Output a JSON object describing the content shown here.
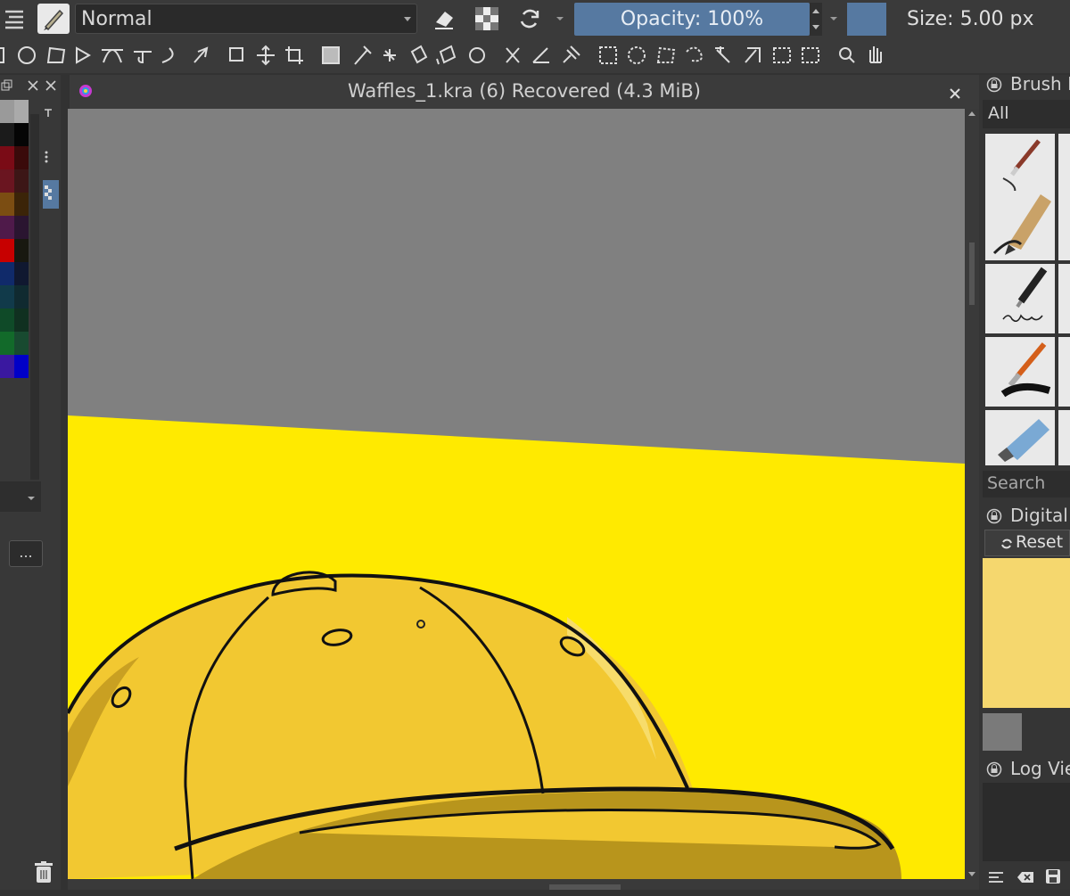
{
  "toolbar": {
    "blend_mode": "Normal",
    "opacity_label": "Opacity: 100%",
    "size_label": "Size: 5.00 px",
    "accent_color": "#5679a1"
  },
  "icons": [
    "menu-icon",
    "brush-preset-icon",
    "eraser-icon",
    "alpha-lock-icon",
    "reload-icon",
    "dropdown-icon"
  ],
  "tools": [
    "rectangle-tool",
    "ellipse-tool",
    "polygon-tool",
    "polyline-tool",
    "bezier-tool",
    "freehand-path-tool",
    "dynamic-brush-tool",
    "multibrush-tool",
    "transform-tool",
    "move-tool",
    "crop-tool",
    "gradient-tool",
    "color-picker-tool",
    "smart-patch-tool",
    "fill-tool",
    "assistant-tool",
    "measure-tool",
    "reference-tool",
    "rect-select-tool",
    "ellipse-select-tool",
    "polygon-select-tool",
    "freehand-select-tool",
    "contiguous-select-tool",
    "similar-select-tool",
    "bezier-select-tool",
    "magnetic-select-tool",
    "zoom-tool",
    "pan-tool"
  ],
  "left_dock": {
    "more_label": "..."
  },
  "canvas": {
    "title": "Waffles_1.kra (6) Recovered (4.3 MiB)",
    "background_color": "#808080",
    "fill_color": "#ffea00",
    "cap_color": "#f2c831"
  },
  "right_dock": {
    "brush_presets_title": "Brush P",
    "filter_value": "All",
    "search_placeholder": "Search",
    "digital_color_title": "Digital C",
    "reset_label": "Reset",
    "log_viewer_title": "Log Vie",
    "mixer_color": "#f5d76e"
  }
}
